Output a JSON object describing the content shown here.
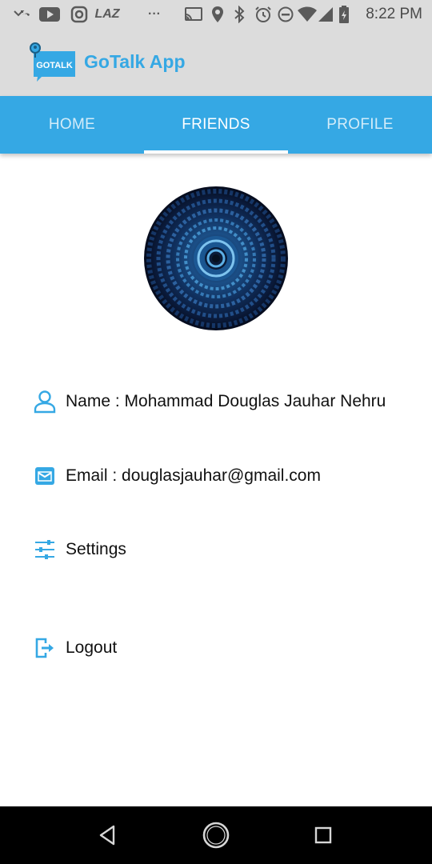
{
  "status_bar": {
    "time": "8:22 PM",
    "carrier_text": "LAZ",
    "overflow": "···"
  },
  "app": {
    "logo_text": "GOTALK",
    "title": "GoTalk App"
  },
  "tabs": [
    {
      "label": "HOME",
      "active": false
    },
    {
      "label": "FRIENDS",
      "active": true
    },
    {
      "label": "PROFILE",
      "active": false
    }
  ],
  "profile": {
    "name_line": "Name : Mohammad Douglas Jauhar Nehru",
    "email_line": "Email : douglasjauhar@gmail.com"
  },
  "menu": {
    "settings_label": "Settings",
    "logout_label": "Logout"
  },
  "icons": {
    "name": "person-icon",
    "email": "mail-icon",
    "settings": "sliders-icon",
    "logout": "logout-icon"
  },
  "colors": {
    "accent": "#35a8e4",
    "app_bar": "#dcdcdc",
    "nav_bar": "#000000"
  }
}
